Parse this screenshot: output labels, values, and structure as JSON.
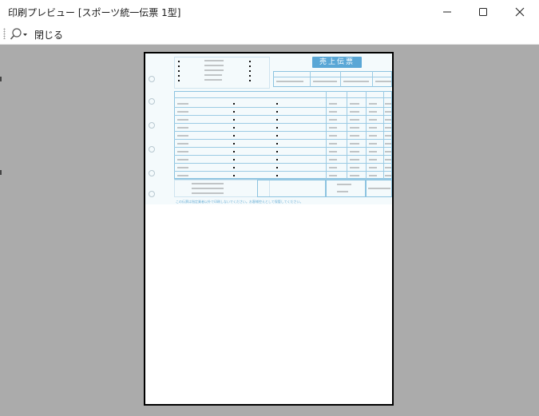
{
  "window": {
    "title": "印刷プレビュー [スポーツ統一伝票 1型]",
    "controls": [
      "minimize",
      "maximize",
      "close"
    ]
  },
  "toolbar": {
    "zoom_icon": "magnifier-dropdown-icon",
    "close_label": "閉じる"
  },
  "preview": {
    "slip_title": "売上伝票",
    "footer_note": "この伝票は指定業者以外で印刷しないでください。お客様控えとして保管してください。",
    "header_labels": [
      "年",
      "月",
      "日",
      "伝票番号"
    ],
    "column_headers": [
      "品番",
      "コード",
      "品名",
      "色",
      "サイズ",
      "数量",
      "単価",
      "金額"
    ]
  },
  "colors": {
    "workspace": "#ababab",
    "slip_accent": "#5aa7d6",
    "page": "#ffffff"
  }
}
